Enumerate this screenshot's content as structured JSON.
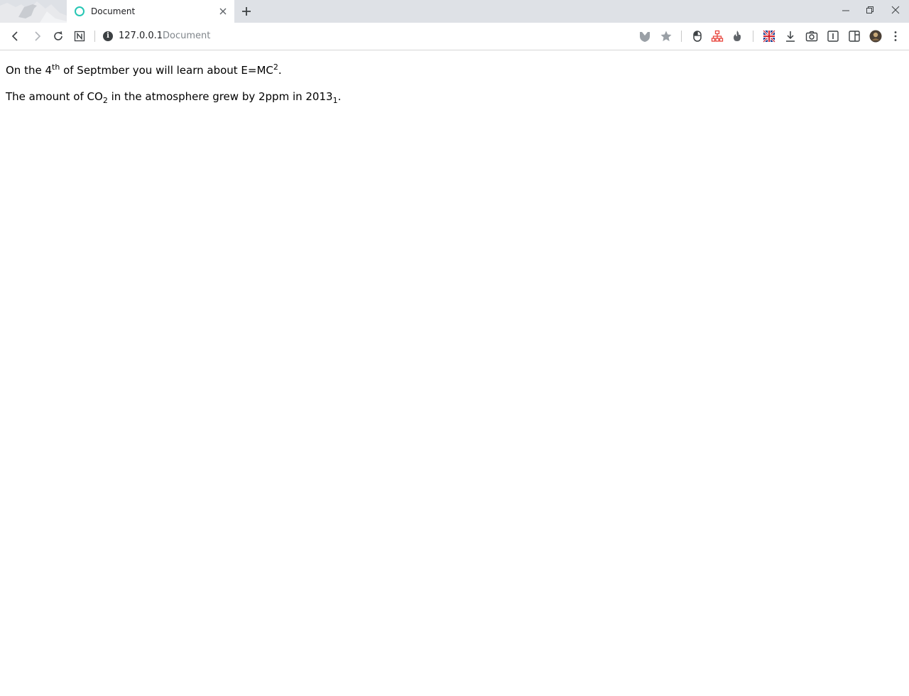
{
  "tab": {
    "title": "Document"
  },
  "address_bar": {
    "host": "127.0.0.1",
    "page_title": "Document"
  },
  "colors": {
    "tab_strip": "#dee1e6",
    "favicon_ring": "#26c6b4",
    "url_title": "#80868b"
  },
  "icons": {
    "back": "back-arrow-icon",
    "forward": "forward-arrow-icon",
    "reload": "reload-icon",
    "notion": "n-box-icon",
    "info": "info-icon",
    "shield": "shield-icon",
    "bookmark": "star-icon",
    "download": "download-icon",
    "screenshot": "camera-icon",
    "menu": "kebab-menu-icon"
  },
  "content": {
    "line1": {
      "before": "On the 4",
      "sup": "th",
      "middle": " of Septmber you will learn about E=MC",
      "sup2": "2",
      "after": "."
    },
    "line2": {
      "before": "The amount of CO",
      "sub": "2",
      "middle": " in the atmosphere grew by 2ppm in 2013",
      "sub2": "1",
      "after": "."
    }
  }
}
